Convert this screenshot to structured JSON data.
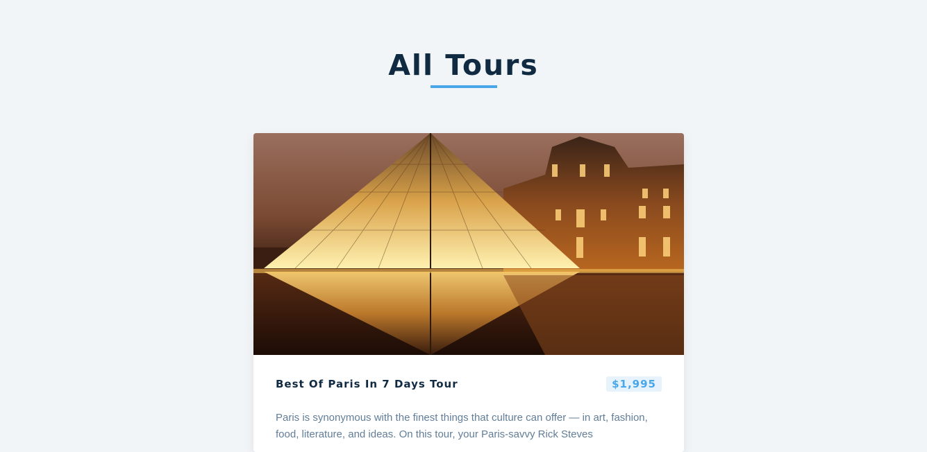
{
  "page": {
    "title": "All Tours"
  },
  "tour": {
    "name": "Best Of Paris In 7 Days Tour",
    "price": "$1,995",
    "description": "Paris is synonymous with the finest things that culture can offer — in art, fashion, food, literature, and ideas. On this tour, your Paris-savvy Rick Steves",
    "image_icon": "louvre-pyramid-photo"
  },
  "colors": {
    "background": "#f1f5f8",
    "heading": "#102a42",
    "accent": "#49a6e9",
    "price_bg": "#e7f3fc",
    "body_text": "#617d98"
  }
}
